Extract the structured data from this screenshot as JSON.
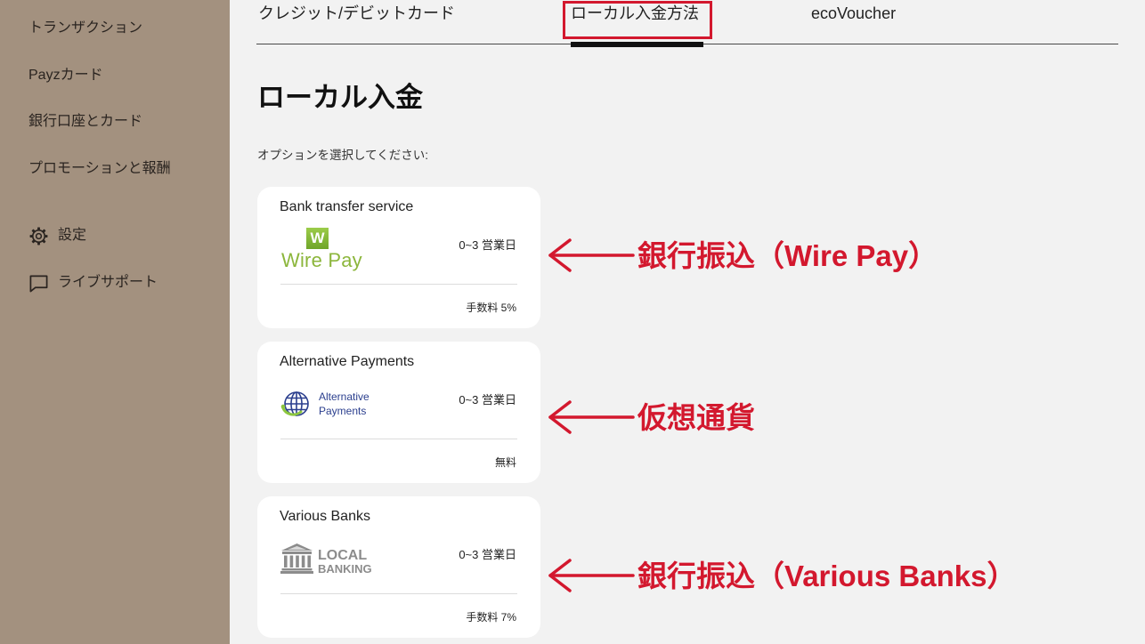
{
  "sidebar": {
    "items": [
      {
        "label": "トランザクション"
      },
      {
        "label": "Payzカード"
      },
      {
        "label": "銀行口座とカード"
      },
      {
        "label": "プロモーションと報酬"
      }
    ],
    "settings": {
      "label": "設定",
      "icon": "gear-icon"
    },
    "support": {
      "label": "ライブサポート",
      "icon": "chat-icon"
    }
  },
  "tabs": [
    {
      "label": "クレジット/デビットカード",
      "active": false
    },
    {
      "label": "ローカル入金方法",
      "active": true
    },
    {
      "label": "ecoVoucher",
      "active": false
    }
  ],
  "main": {
    "title": "ローカル入金",
    "prompt": "オプションを選択してください:"
  },
  "options": [
    {
      "title": "Bank transfer service",
      "logo": {
        "mark": "W",
        "text": "Wire Pay"
      },
      "duration": "0~3 営業日",
      "fee": "手数料 5%"
    },
    {
      "title": "Alternative Payments",
      "logo": {
        "icon": "globe-icon",
        "line1": "Alternative",
        "line2": "Payments"
      },
      "duration": "0~3 営業日",
      "fee": "無料"
    },
    {
      "title": "Various Banks",
      "logo": {
        "icon": "bank-icon",
        "line1": "LOCAL",
        "line2": "BANKING"
      },
      "duration": "0~3 営業日",
      "fee": "手数料 7%"
    }
  ],
  "annotations": [
    {
      "text": "銀行振込（Wire Pay）"
    },
    {
      "text": "仮想通貨"
    },
    {
      "text": "銀行振込（Various Banks）"
    }
  ],
  "colors": {
    "sidebar_bg": "#a3917f",
    "page_bg": "#f2f2f2",
    "annotation_red": "#d3182e",
    "wirepay_green": "#8cb63c",
    "alt_payments_blue": "#2b3f8e",
    "local_banking_gray": "#8c8c8c"
  }
}
